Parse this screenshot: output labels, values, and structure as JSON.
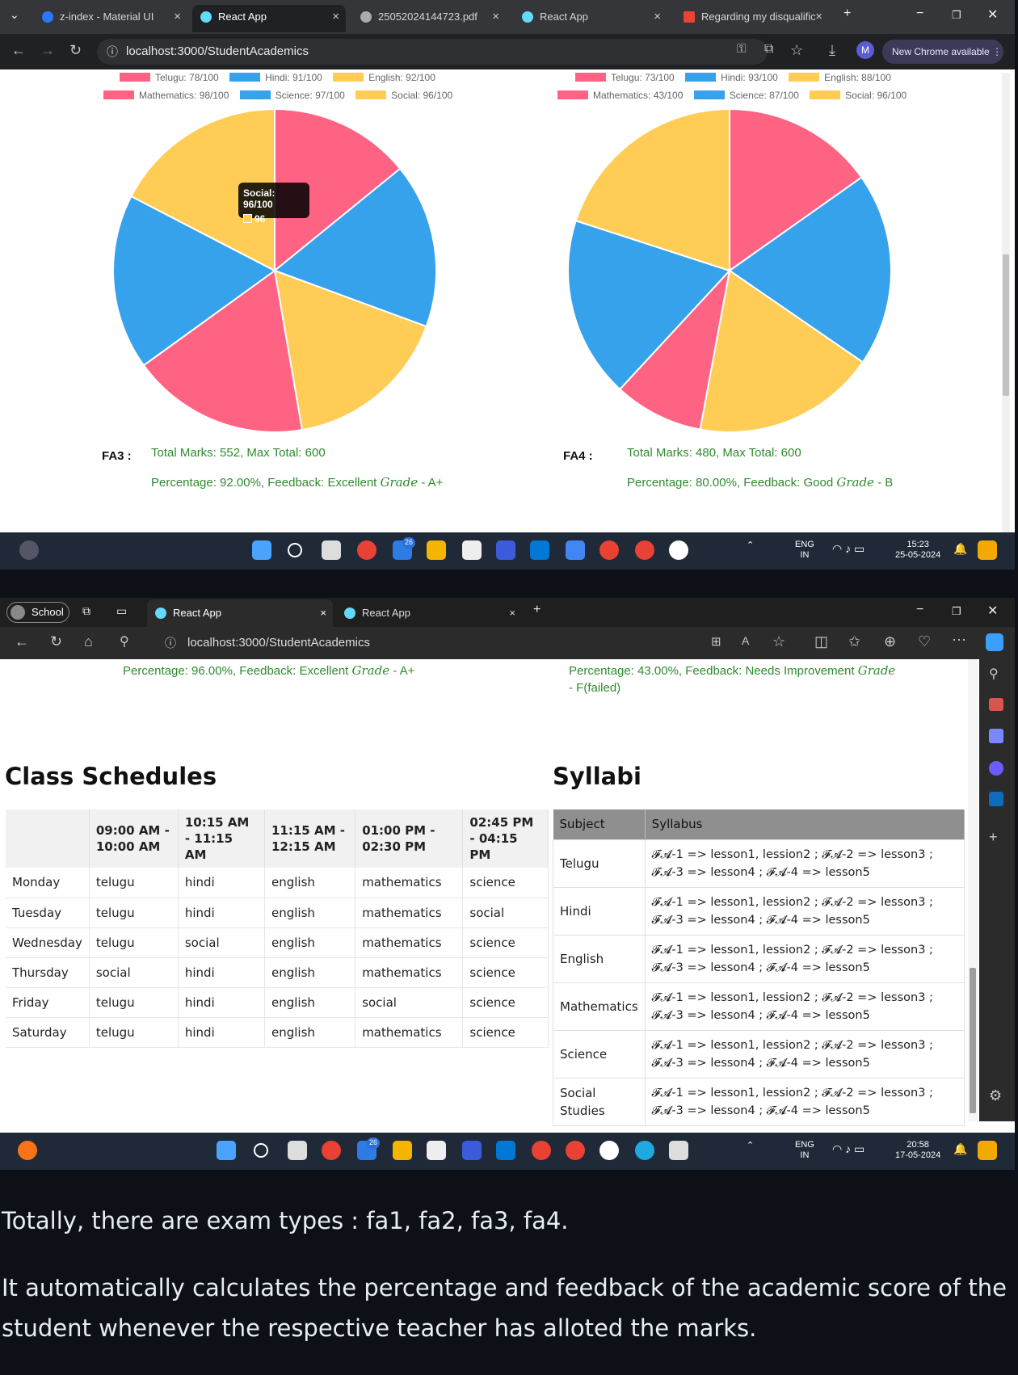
{
  "screenshot1": {
    "tabs": [
      {
        "label": "z-index - Material UI"
      },
      {
        "label": "React App"
      },
      {
        "label": "25052024144723.pdf"
      },
      {
        "label": "React App"
      },
      {
        "label": "Regarding my disqualific"
      }
    ],
    "url": "localhost:3000/StudentAcademics",
    "new_chrome": "New Chrome available",
    "fa3": {
      "label": "FA3 :",
      "legend_row1": [
        "Telugu: 78/100",
        "Hindi: 91/100",
        "English: 92/100"
      ],
      "legend_row2": [
        "Mathematics: 98/100",
        "Science: 97/100",
        "Social: 96/100"
      ],
      "total": "Total Marks: 552, Max Total: 600",
      "percentage": "Percentage: 92.00%, Feedback: Excellent",
      "grade_word": "Grade",
      "grade_value": " - A+",
      "tooltip_title": "Social: 96/100",
      "tooltip_value": "96"
    },
    "fa4": {
      "label": "FA4 :",
      "legend_row1": [
        "Telugu: 73/100",
        "Hindi: 93/100",
        "English: 88/100"
      ],
      "legend_row2": [
        "Mathematics: 43/100",
        "Science: 87/100",
        "Social: 96/100"
      ],
      "total": "Total Marks: 480, Max Total: 600",
      "percentage": "Percentage: 80.00%, Feedback: Good",
      "grade_word": "Grade",
      "grade_value": " - B"
    },
    "taskbar": {
      "lang": "ENG",
      "region": "IN",
      "time": "15:23",
      "date": "25-05-2024",
      "badge": "26"
    }
  },
  "chart_data": [
    {
      "type": "pie",
      "categories": [
        "Telugu",
        "Hindi",
        "English",
        "Mathematics",
        "Science",
        "Social"
      ],
      "values": [
        78,
        91,
        92,
        98,
        97,
        96
      ],
      "colors": [
        "#ff6384",
        "#36a2eb",
        "#ffcd56",
        "#ff6384",
        "#36a2eb",
        "#ffcd56"
      ]
    },
    {
      "type": "pie",
      "categories": [
        "Telugu",
        "Hindi",
        "English",
        "Mathematics",
        "Science",
        "Social"
      ],
      "values": [
        73,
        93,
        88,
        43,
        87,
        96
      ],
      "colors": [
        "#ff6384",
        "#36a2eb",
        "#ffcd56",
        "#ff6384",
        "#36a2eb",
        "#ffcd56"
      ]
    }
  ],
  "screenshot2": {
    "profile": "School",
    "tabs": [
      {
        "label": "React App"
      },
      {
        "label": "React App"
      }
    ],
    "url": "localhost:3000/StudentAcademics",
    "left_percentage": "Percentage: 96.00%, Feedback: Excellent",
    "left_grade_word": "Grade",
    "left_grade_value": " - A+",
    "right_percentage": "Percentage: 43.00%, Feedback: Needs Improvement",
    "right_grade_word": "Grade",
    "right_grade_value": "- F(failed)",
    "class_schedules_title": "Class Schedules",
    "syllabi_title": "Syllabi",
    "schedule": {
      "headers": [
        "",
        "09:00 AM - 10:00 AM",
        "10:15 AM - 11:15 AM",
        "11:15 AM - 12:15 AM",
        "01:00 PM - 02:30 PM",
        "02:45 PM - 04:15 PM"
      ],
      "rows": [
        [
          "Monday",
          "telugu",
          "hindi",
          "english",
          "mathematics",
          "science"
        ],
        [
          "Tuesday",
          "telugu",
          "hindi",
          "english",
          "mathematics",
          "social"
        ],
        [
          "Wednesday",
          "telugu",
          "social",
          "english",
          "mathematics",
          "science"
        ],
        [
          "Thursday",
          "social",
          "hindi",
          "english",
          "mathematics",
          "science"
        ],
        [
          "Friday",
          "telugu",
          "hindi",
          "english",
          "social",
          "science"
        ],
        [
          "Saturday",
          "telugu",
          "hindi",
          "english",
          "mathematics",
          "science"
        ]
      ]
    },
    "syllabi": {
      "headers": [
        "Subject",
        "Syllabus"
      ],
      "rows": [
        {
          "subject": "Telugu",
          "syllabus": "𝓕𝓐-1 => lesson1, lession2 ; 𝓕𝓐-2 => lesson3 ; 𝓕𝓐-3 => lesson4 ; 𝓕𝓐-4 => lesson5"
        },
        {
          "subject": "Hindi",
          "syllabus": "𝓕𝓐-1 => lesson1, lession2 ; 𝓕𝓐-2 => lesson3 ; 𝓕𝓐-3 => lesson4 ; 𝓕𝓐-4 => lesson5"
        },
        {
          "subject": "English",
          "syllabus": "𝓕𝓐-1 => lesson1, lession2 ; 𝓕𝓐-2 => lesson3 ; 𝓕𝓐-3 => lesson4 ; 𝓕𝓐-4 => lesson5"
        },
        {
          "subject": "Mathematics",
          "syllabus": "𝓕𝓐-1 => lesson1, lession2 ; 𝓕𝓐-2 => lesson3 ; 𝓕𝓐-3 => lesson4 ; 𝓕𝓐-4 => lesson5"
        },
        {
          "subject": "Science",
          "syllabus": "𝓕𝓐-1 => lesson1, lession2 ; 𝓕𝓐-2 => lesson3 ; 𝓕𝓐-3 => lesson4 ; 𝓕𝓐-4 => lesson5"
        },
        {
          "subject": "Social Studies",
          "syllabus": "𝓕𝓐-1 => lesson1, lession2 ; 𝓕𝓐-2 => lesson3 ; 𝓕𝓐-3 => lesson4 ; 𝓕𝓐-4 => lesson5"
        }
      ]
    },
    "taskbar": {
      "lang": "ENG",
      "region": "IN",
      "time": "20:58",
      "date": "17-05-2024",
      "badge": "26"
    }
  },
  "caption": {
    "line1": "Totally, there are exam types : fa1, fa2, fa3, fa4.",
    "line2": "It automatically calculates the percentage and feedback of the academic score of the",
    "line3": "student whenever the respective teacher has alloted the marks."
  }
}
